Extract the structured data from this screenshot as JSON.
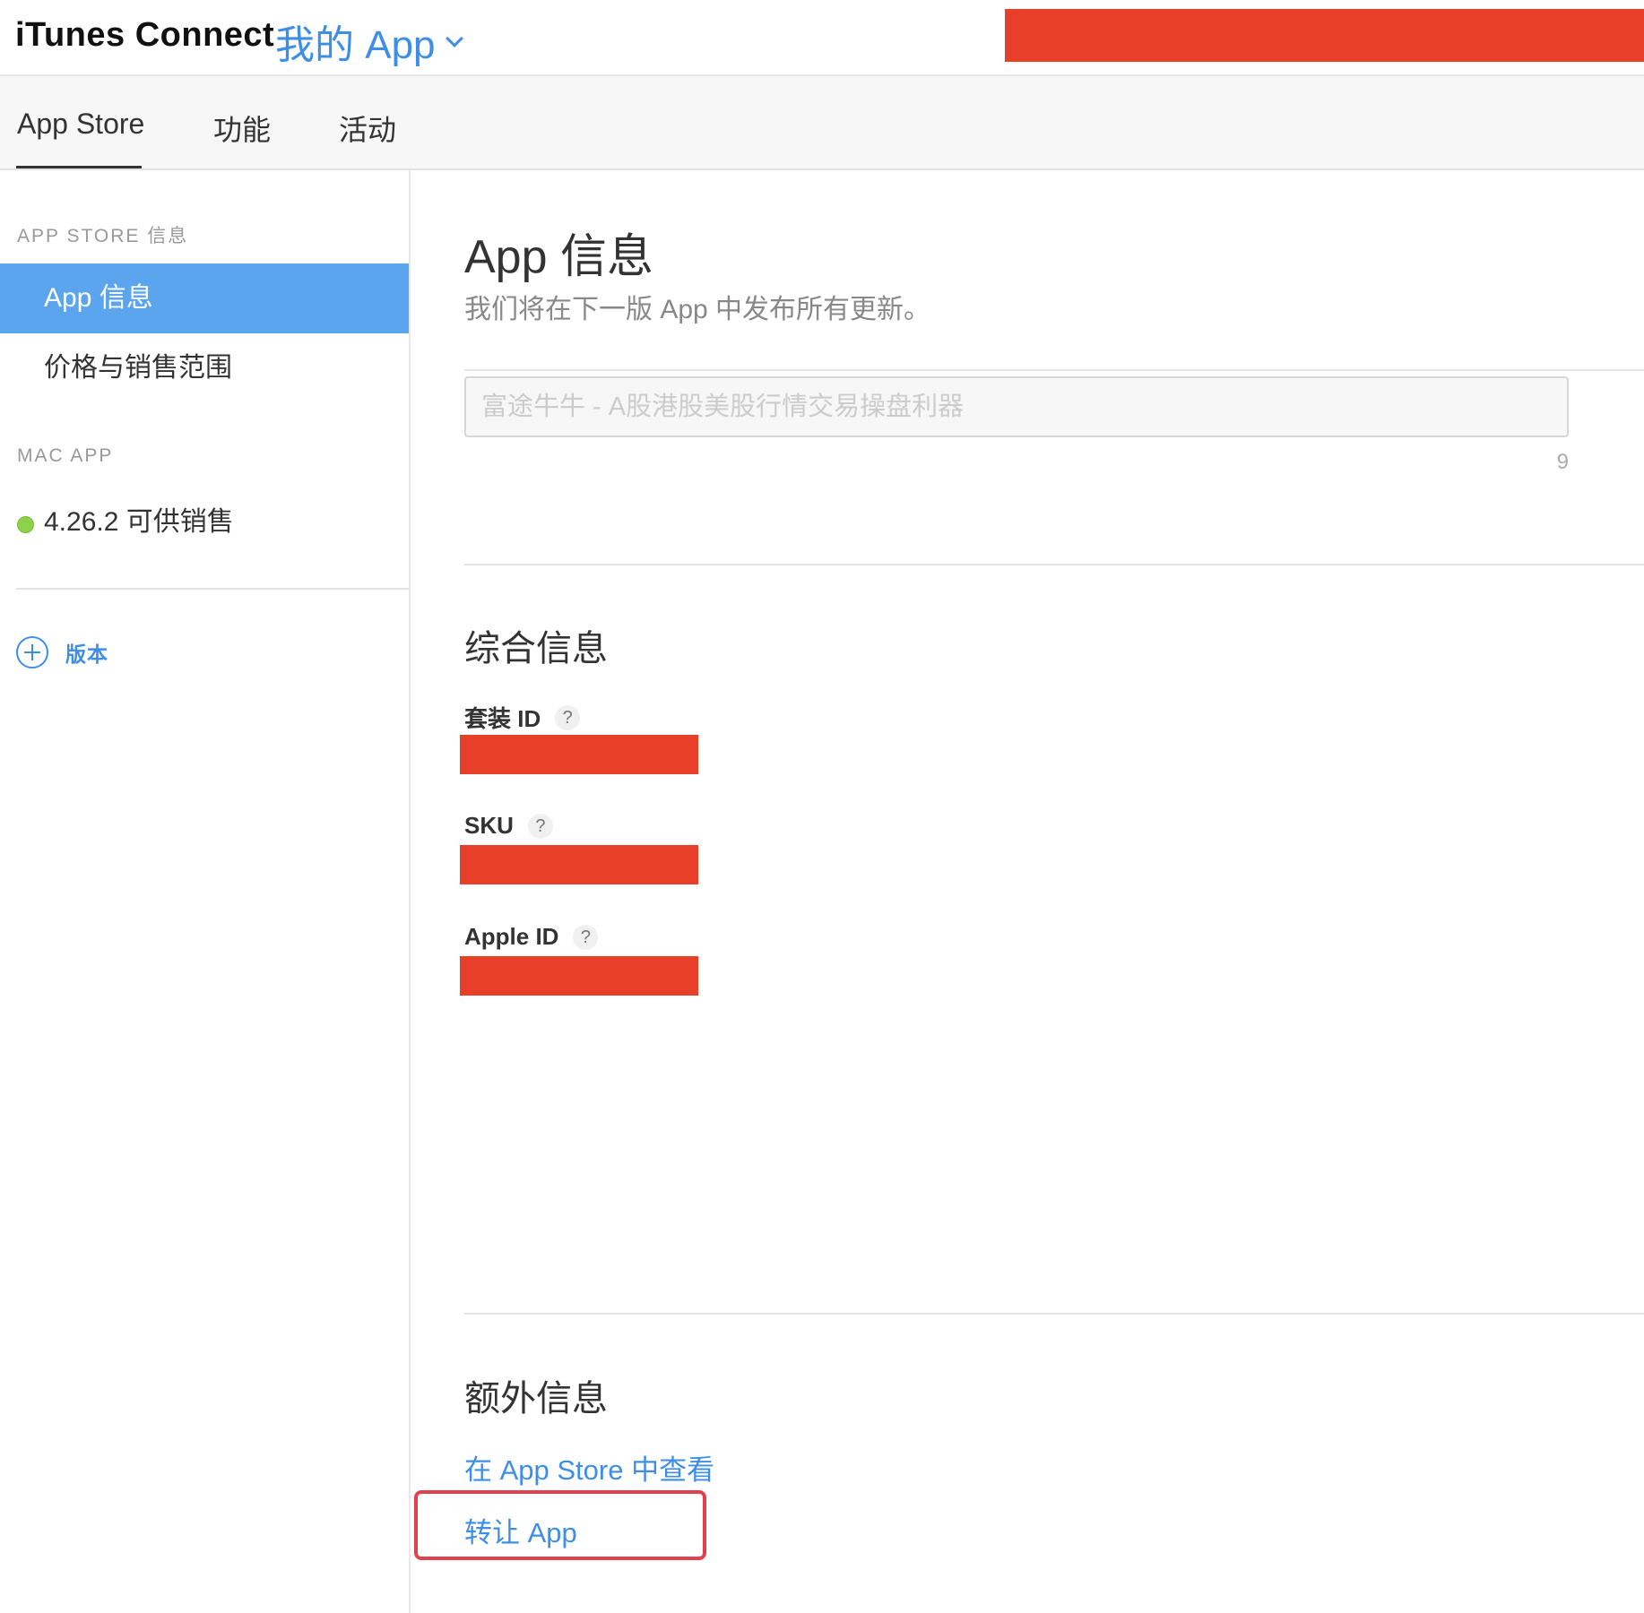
{
  "header": {
    "brand": "iTunes Connect",
    "app_menu_label": "我的 App"
  },
  "tabs": [
    {
      "label": "App Store",
      "active": true
    },
    {
      "label": "功能",
      "active": false
    },
    {
      "label": "活动",
      "active": false
    }
  ],
  "sidebar": {
    "section_app_store": "APP STORE 信息",
    "items": [
      {
        "label": "App 信息",
        "selected": true
      },
      {
        "label": "价格与销售范围",
        "selected": false
      }
    ],
    "section_mac_app": "MAC APP",
    "version_status": "4.26.2 可供销售",
    "add_version_label": "版本"
  },
  "main": {
    "title": "App 信息",
    "subtitle": "我们将在下一版 App 中发布所有更新。",
    "name_field": {
      "placeholder": "富途牛牛 - A股港股美股行情交易操盘利器",
      "char_count": "9"
    },
    "general_info": {
      "title": "综合信息",
      "fields": [
        {
          "label": "套装 ID",
          "help": "?"
        },
        {
          "label": "SKU",
          "help": "?"
        },
        {
          "label": "Apple ID",
          "help": "?"
        }
      ]
    },
    "additional_info": {
      "title": "额外信息",
      "links": [
        "在 App Store 中查看",
        "转让 App"
      ]
    }
  },
  "colors": {
    "accent": "#3f8ee6",
    "selected_bg": "#5aa5ee",
    "redaction": "#e83f28",
    "highlight": "#e0414d",
    "status_green": "#8cd24b"
  }
}
